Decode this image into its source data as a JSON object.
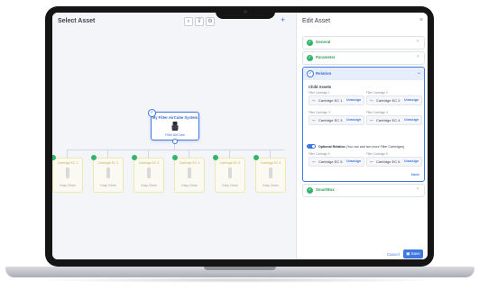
{
  "left_panel": {
    "title": "Select Asset",
    "toolbar": {
      "search_icon": "⌕",
      "filter_icon": "⊽",
      "settings_icon": "⚙",
      "add_label": "+"
    }
  },
  "parent_node": {
    "title": "My Filter AirCube System",
    "subtitle": "Filter AirCube"
  },
  "children": [
    {
      "title": "Cartridge EC 1",
      "subtitle": "Easy Clean"
    },
    {
      "title": "Cartridge EC 2",
      "subtitle": "Easy Clean"
    },
    {
      "title": "Cartridge EC 3",
      "subtitle": "Easy Clean"
    },
    {
      "title": "Cartridge EC 4",
      "subtitle": "Easy Clean"
    },
    {
      "title": "Cartridge EC 5",
      "subtitle": "Easy Clean"
    },
    {
      "title": "Cartridge EC 6",
      "subtitle": "Easy Clean"
    }
  ],
  "right_panel": {
    "title": "Edit Asset",
    "close": "×",
    "sections": {
      "general": "General",
      "parameter": "Parameter",
      "relation": "Relation",
      "smartbox": "SmartBox"
    },
    "relation": {
      "child_assets_label": "Child Assets",
      "slots": [
        {
          "label": "Filter Cartridge 1",
          "value": "Cartridge EC 1",
          "action": "Unassign"
        },
        {
          "label": "Filter Cartridge 2",
          "value": "Cartridge EC 2",
          "action": "Unassign"
        },
        {
          "label": "Filter Cartridge 3",
          "value": "Cartridge EC 3",
          "action": "Unassign"
        },
        {
          "label": "Filter Cartridge 4",
          "value": "Cartridge EC 4",
          "action": "Unassign"
        },
        {
          "label": "Filter Cartridge 5",
          "value": "Cartridge EC 5",
          "action": "Unassign"
        },
        {
          "label": "Filter Cartridge 6",
          "value": "Cartridge EC 6",
          "action": "Unassign"
        }
      ],
      "optional_title": "Optional Relation",
      "optional_desc": "(You can add two more Filter Cartridges)",
      "next": "Next"
    },
    "footer": {
      "cancel": "Cancel",
      "save": "Save"
    }
  },
  "colors": {
    "accent": "#3f78e0",
    "success": "#34b36a",
    "child_border": "#efe6b0"
  }
}
